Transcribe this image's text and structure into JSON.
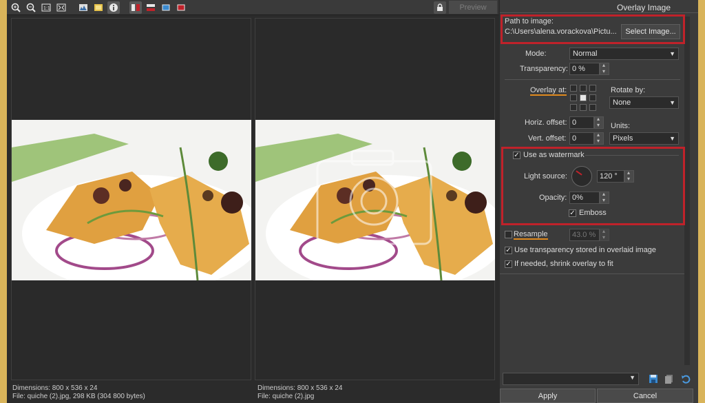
{
  "toolbar": {
    "preview_label": "Preview",
    "icons": [
      "zoom-in-icon",
      "zoom-out-icon",
      "actual-size-icon",
      "fit-icon",
      "histogram-icon",
      "highlight-icon",
      "info-icon",
      "split-vertical-icon",
      "split-horizontal-icon",
      "single-view-icon",
      "original-view-icon"
    ]
  },
  "panel": {
    "title": "Overlay Image",
    "path_label": "Path to image:",
    "path_value": "C:\\Users\\alena.vorackova\\Pictu...",
    "select_image": "Select Image...",
    "mode_label": "Mode:",
    "mode_value": "Normal",
    "transparency_label": "Transparency:",
    "transparency_value": "0 %",
    "overlay_at_label": "Overlay at:",
    "rotate_by_label": "Rotate by:",
    "rotate_by_value": "None",
    "horiz_offset_label": "Horiz. offset:",
    "horiz_offset_value": "0",
    "vert_offset_label": "Vert. offset:",
    "vert_offset_value": "0",
    "units_label": "Units:",
    "units_value": "Pixels",
    "use_as_watermark": "Use as watermark",
    "light_source_label": "Light source:",
    "light_source_value": "120 °",
    "opacity_label": "Opacity:",
    "opacity_value": "0%",
    "emboss_label": "Emboss",
    "resample_label": "Resample",
    "resample_value": "43.0 %",
    "use_transparency": "Use transparency stored in overlaid image",
    "shrink_overlay": "If needed, shrink overlay to fit",
    "apply": "Apply",
    "cancel": "Cancel"
  },
  "left_pane": {
    "dimensions": "Dimensions: 800 x 536 x 24",
    "file": "File: quiche (2).jpg, 298 KB (304 800 bytes)"
  },
  "right_pane": {
    "dimensions": "Dimensions: 800 x 536 x 24",
    "file": "File: quiche (2).jpg"
  },
  "colors": {
    "frame": "#d9b45a",
    "highlight_box": "#c0222a",
    "underline": "#e08a1e"
  }
}
